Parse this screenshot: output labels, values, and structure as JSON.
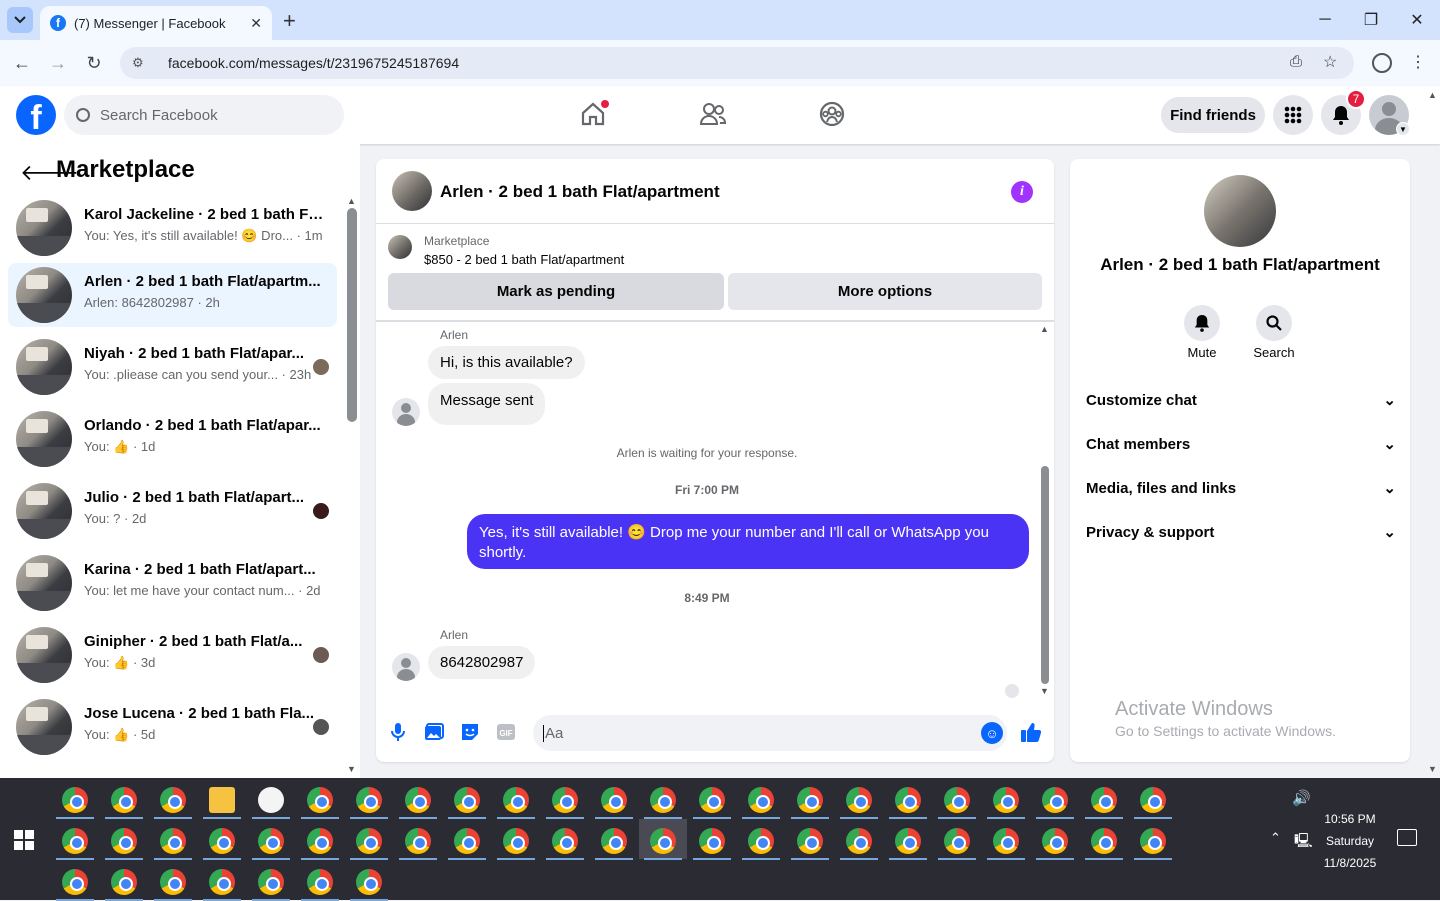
{
  "browser": {
    "tab_title": "(7) Messenger | Facebook",
    "url": "facebook.com/messages/t/2319675245187694"
  },
  "header": {
    "search_placeholder": "Search Facebook",
    "find_friends": "Find friends",
    "notification_count": "7"
  },
  "left": {
    "title": "Marketplace",
    "conversations": [
      {
        "name": "Karol Jackeline · 2 bed 1 bath Fla...",
        "preview": "You: Yes, it's still available! 😊 Dro... · 1m"
      },
      {
        "name": "Arlen · 2 bed 1 bath Flat/apartm...",
        "preview": "Arlen: 8642802987 · 2h"
      },
      {
        "name": "Niyah · 2 bed 1 bath Flat/apar...",
        "preview": "You: .pliease can you send your... · 23h"
      },
      {
        "name": "Orlando · 2 bed 1 bath Flat/apar...",
        "preview": "You: 👍 · 1d"
      },
      {
        "name": "Julio · 2 bed 1 bath Flat/apart...",
        "preview": "You: ? · 2d"
      },
      {
        "name": "Karina · 2 bed 1 bath Flat/apart...",
        "preview": "You: let me have your contact num... · 2d"
      },
      {
        "name": "Ginipher · 2 bed 1 bath Flat/a...",
        "preview": "You: 👍 · 3d"
      },
      {
        "name": "Jose Lucena · 2 bed 1 bath Fla...",
        "preview": "You: 👍 · 5d"
      }
    ]
  },
  "chat": {
    "title": "Arlen · 2 bed 1 bath Flat/apartment",
    "marketplace_label": "Marketplace",
    "listing": "$850 - 2 bed 1 bath Flat/apartment",
    "mark_pending": "Mark as pending",
    "more_options": "More options",
    "sender1": "Arlen",
    "msg1": "Hi, is this available?",
    "msg2": "Message sent",
    "waiting": "Arlen is waiting for your response.",
    "time1": "Fri 7:00 PM",
    "outgoing": "Yes, it's still available! 😊 Drop me your number and I'll call or WhatsApp you shortly.",
    "time2": "8:49 PM",
    "sender2": "Arlen",
    "msg3": "8642802987",
    "composer_placeholder": "Aa"
  },
  "details": {
    "name": "Arlen · 2 bed 1 bath Flat/apartment",
    "mute": "Mute",
    "search": "Search",
    "sections": [
      "Customize chat",
      "Chat members",
      "Media, files and links",
      "Privacy & support"
    ]
  },
  "watermark": {
    "line1": "Activate Windows",
    "line2": "Go to Settings to activate Windows."
  },
  "taskbar": {
    "time": "10:56 PM",
    "day": "Saturday",
    "date": "11/8/2025"
  },
  "colors": {
    "fb_blue": "#0866ff",
    "outgoing_bubble": "#4b33f5",
    "badge_red": "#e41e3f",
    "active_conv": "#ebf5ff"
  }
}
